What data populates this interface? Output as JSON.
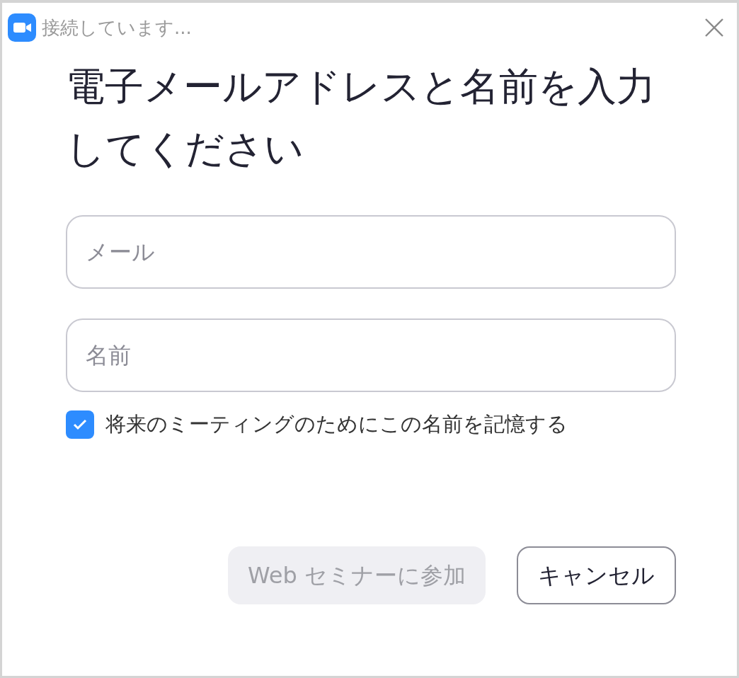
{
  "window": {
    "title": "接続しています..."
  },
  "heading": "電子メールアドレスと名前を入力してください",
  "fields": [
    {
      "placeholder": "メール"
    },
    {
      "placeholder": "名前"
    }
  ],
  "remember": {
    "label": "将来のミーティングのためにこの名前を記憶する",
    "checked": true
  },
  "buttons": [
    {
      "label": "Web セミナーに参加",
      "kind": "primary",
      "disabled": true
    },
    {
      "label": "キャンセル",
      "kind": "secondary",
      "disabled": false
    }
  ]
}
